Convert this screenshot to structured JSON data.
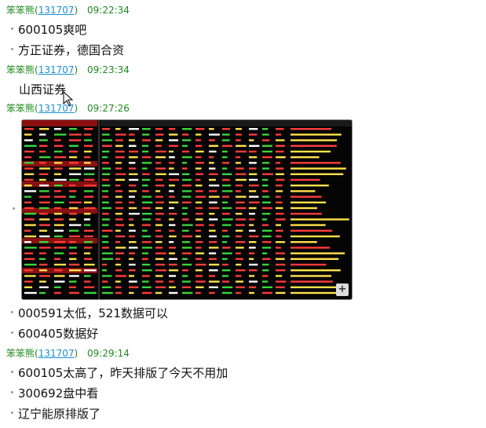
{
  "messages": [
    {
      "type": "header",
      "user": "笨笨熊",
      "uid": "131707",
      "time": "09:22:34"
    },
    {
      "type": "text",
      "text": "600105爽吧"
    },
    {
      "type": "text",
      "text": "方正证券，德国合资"
    },
    {
      "type": "header",
      "user": "笨笨熊",
      "uid": "131707",
      "time": "09:23:34"
    },
    {
      "type": "text",
      "text": "山西证券"
    },
    {
      "type": "header",
      "user": "笨笨熊",
      "uid": "131707",
      "time": "09:27:26"
    },
    {
      "type": "image",
      "alt": "stock software screenshot"
    },
    {
      "type": "text",
      "text": "000591太低，521数据可以"
    },
    {
      "type": "text",
      "text": "600405数据好"
    },
    {
      "type": "header",
      "user": "笨笨熊",
      "uid": "131707",
      "time": "09:29:14"
    },
    {
      "type": "text",
      "text": "600105太高了，昨天排版了今天不用加"
    },
    {
      "type": "text",
      "text": "300692盘中看"
    },
    {
      "type": "text",
      "text": "辽宁能原排版了"
    }
  ],
  "image_zoom_label": "+"
}
